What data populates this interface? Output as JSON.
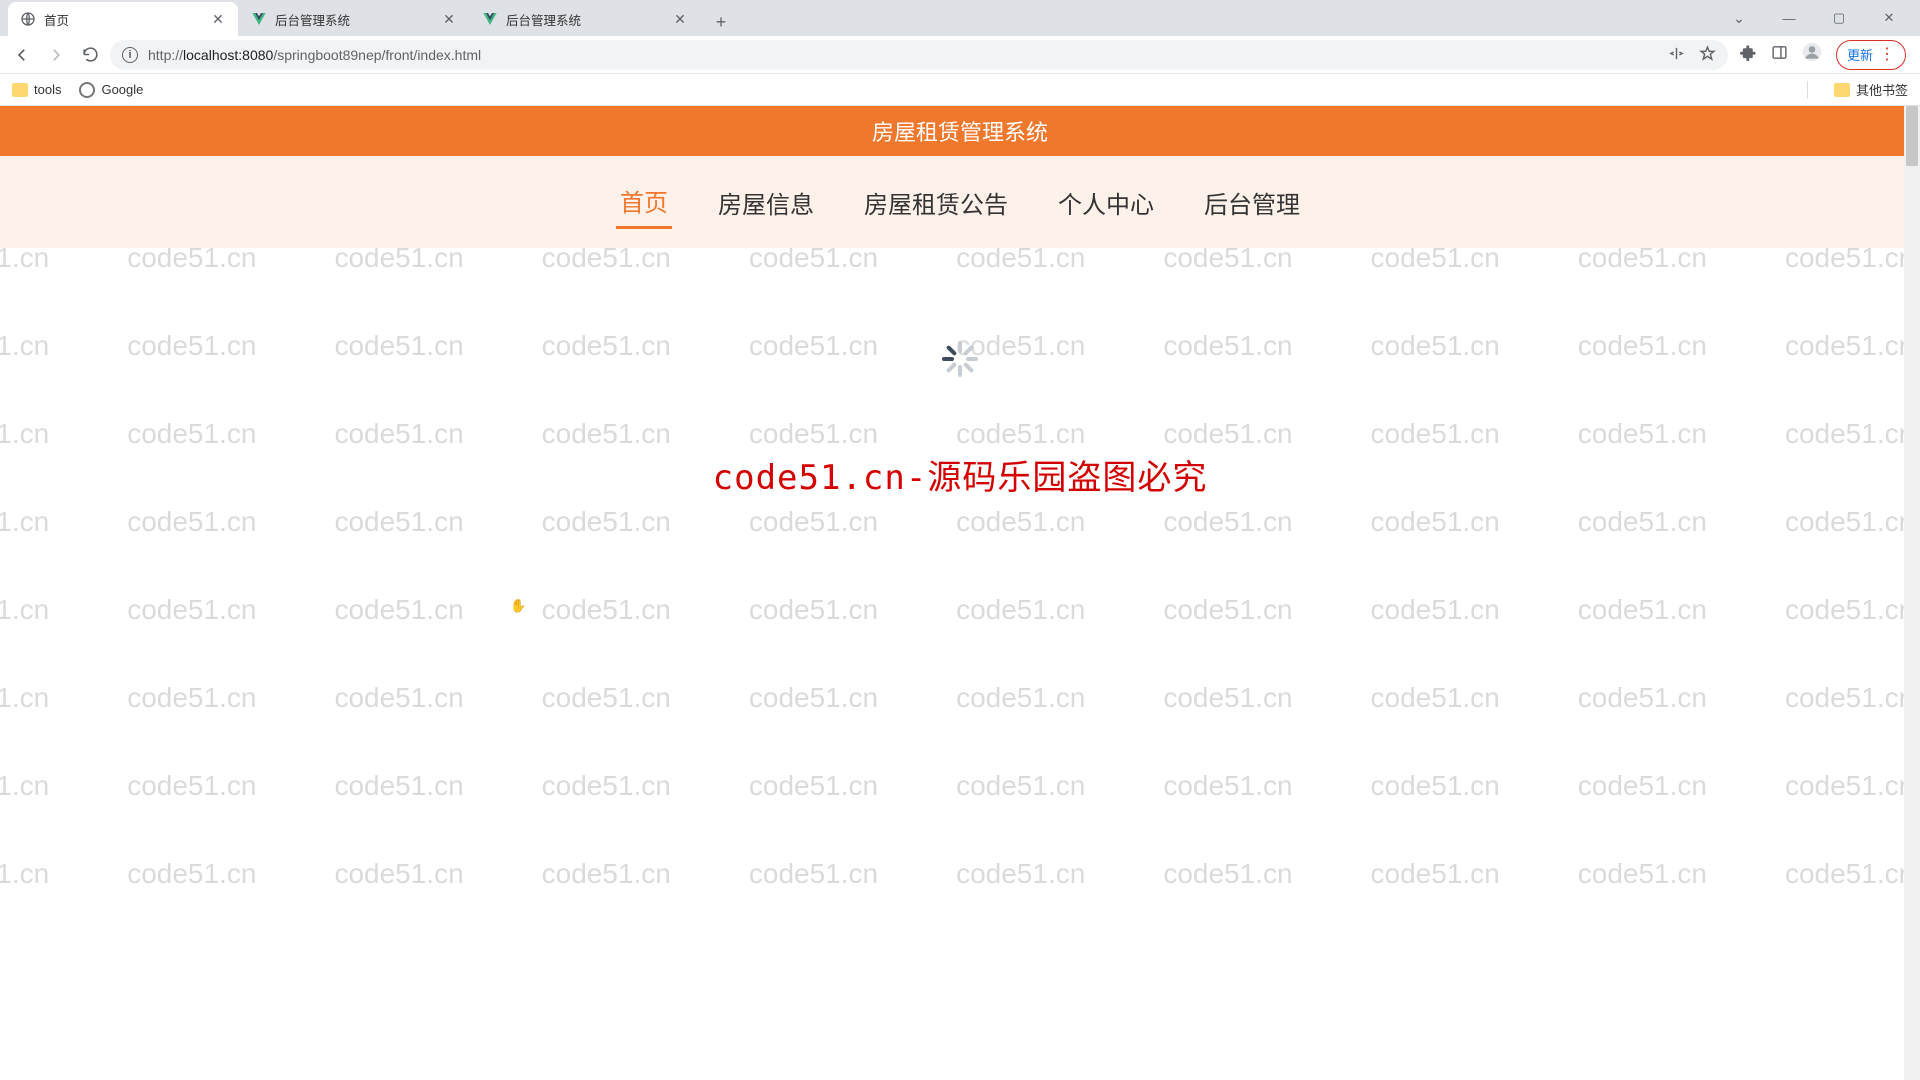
{
  "browser": {
    "tabs": [
      {
        "title": "首页",
        "favicon": "globe"
      },
      {
        "title": "后台管理系统",
        "favicon": "vue"
      },
      {
        "title": "后台管理系统",
        "favicon": "vue"
      }
    ],
    "url_host": "localhost:8080",
    "url_path": "/springboot89nep/front/index.html",
    "url_scheme": "http://",
    "update_label": "更新"
  },
  "bookmarks": {
    "items": [
      {
        "label": "tools",
        "icon": "folder"
      },
      {
        "label": "Google",
        "icon": "google"
      }
    ],
    "other": "其他书签"
  },
  "site": {
    "title": "房屋租赁管理系统",
    "nav": [
      {
        "label": "首页",
        "active": true
      },
      {
        "label": "房屋信息",
        "active": false
      },
      {
        "label": "房屋租赁公告",
        "active": false
      },
      {
        "label": "个人中心",
        "active": false
      },
      {
        "label": "后台管理",
        "active": false
      }
    ]
  },
  "watermark": "code51.cn",
  "overlay_text": "code51.cn-源码乐园盗图必究"
}
